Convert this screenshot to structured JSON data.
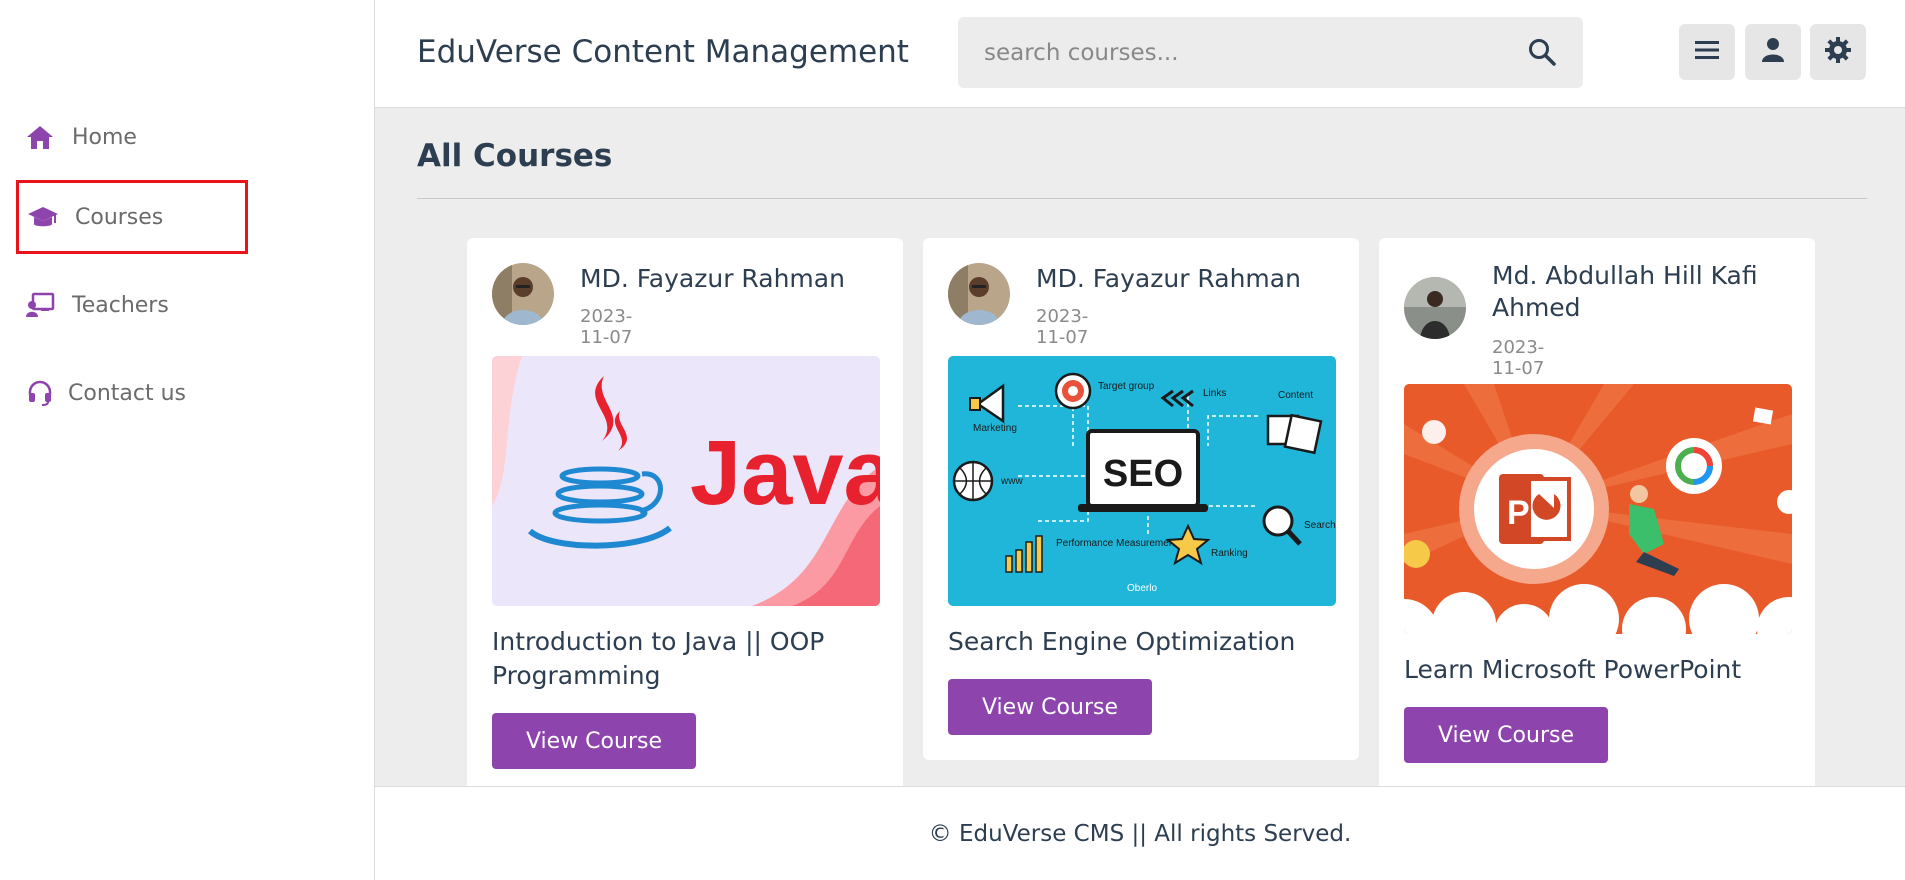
{
  "sidebar": {
    "items": [
      {
        "label": "Home",
        "icon": "home-icon"
      },
      {
        "label": "Courses",
        "icon": "graduation-cap-icon",
        "active": true
      },
      {
        "label": "Teachers",
        "icon": "teacher-board-icon"
      },
      {
        "label": "Contact us",
        "icon": "headset-icon"
      }
    ]
  },
  "header": {
    "brand": "EduVerse Content Management",
    "search_placeholder": "search courses...",
    "buttons": [
      "menu-icon",
      "user-icon",
      "settings-icon"
    ]
  },
  "main": {
    "title": "All Courses",
    "courses": [
      {
        "author": "MD. Fayazur Rahman",
        "date": "2023-11-07",
        "title": "Introduction to Java || OOP Programming",
        "button": "View Course",
        "thumb_text": "Java"
      },
      {
        "author": "MD. Fayazur Rahman",
        "date": "2023-11-07",
        "title": "Search Engine Optimization",
        "button": "View Course",
        "thumb_text": "SEO",
        "thumb_labels": [
          "Marketing",
          "Target group",
          "Links",
          "Content",
          "www",
          "Performance Measurement",
          "Ranking",
          "Search",
          "Oberlo"
        ]
      },
      {
        "author": "Md. Abdullah Hill Kafi Ahmed",
        "date": "2023-11-07",
        "title": "Learn Microsoft PowerPoint",
        "button": "View Course",
        "thumb_text": "P"
      }
    ]
  },
  "footer": {
    "text": "© EduVerse CMS || All rights Served."
  },
  "colors": {
    "accent": "#8e44ad",
    "highlight": "#e8141a",
    "background": "#ededed"
  }
}
